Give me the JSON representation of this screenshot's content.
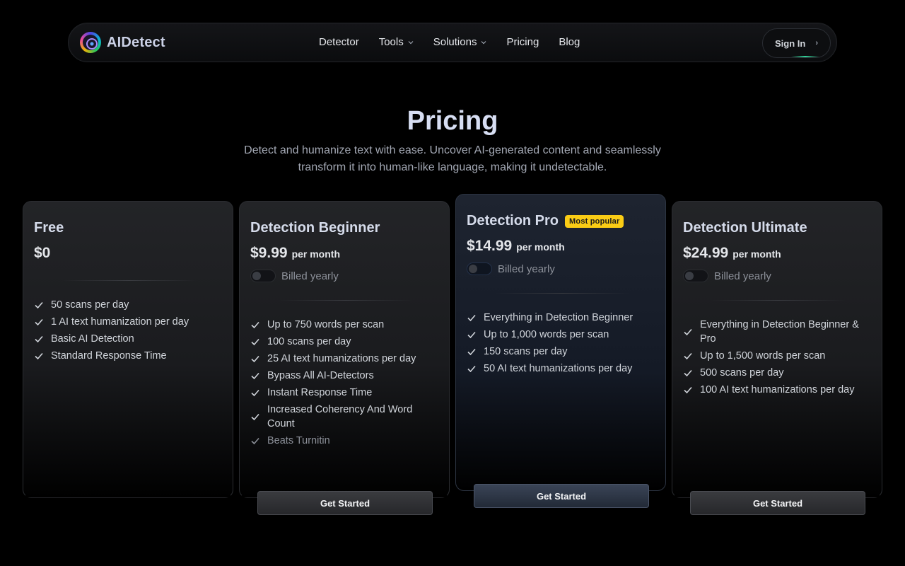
{
  "brand": {
    "name": "AIDetect"
  },
  "nav": {
    "links": [
      "Detector",
      "Tools",
      "Solutions",
      "Pricing",
      "Blog"
    ],
    "signin": "Sign In",
    "signin_arrow": "›"
  },
  "hero": {
    "title": "Pricing",
    "subtitle": "Detect and humanize text with ease. Uncover AI-generated content and seamlessly transform it into human-like language, making it undetectable."
  },
  "plans": [
    {
      "name": "Free",
      "price": "$0",
      "features": [
        "50 scans per day",
        "1 AI text humanization per day",
        "Basic AI Detection",
        "Standard Response Time"
      ]
    },
    {
      "name": "Detection Beginner",
      "price": "$9.99",
      "unit": "per month",
      "billing": "Billed yearly",
      "features": [
        "Up to 750 words per scan",
        "100 scans per day",
        "25 AI text humanizations per day",
        "Bypass All AI-Detectors",
        "Instant Response Time",
        "Increased Coherency And Word Count",
        "Beats Turnitin"
      ],
      "cta": "Get Started"
    },
    {
      "name": "Detection Pro",
      "badge": "Most popular",
      "price": "$14.99",
      "unit": "per month",
      "billing": "Billed yearly",
      "features": [
        "Everything in Detection Beginner",
        "Up to 1,000 words per scan",
        "150 scans per day",
        "50 AI text humanizations per day"
      ],
      "cta": "Get Started"
    },
    {
      "name": "Detection Ultimate",
      "price": "$24.99",
      "unit": "per month",
      "billing": "Billed yearly",
      "features": [
        "Everything in Detection Beginner & Pro",
        "Up to 1,500 words per scan",
        "500 scans per day",
        "100 AI text humanizations per day"
      ],
      "cta": "Get Started"
    }
  ],
  "colors": {
    "badge": "#facc15",
    "background": "#000000",
    "title": "#d7def3"
  }
}
